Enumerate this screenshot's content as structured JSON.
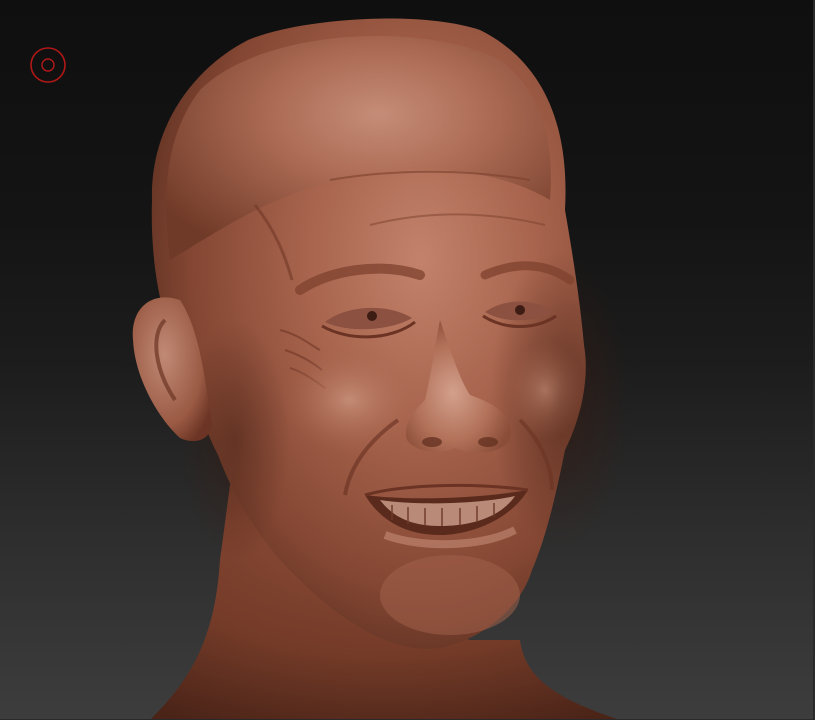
{
  "viewport": {
    "background_top": "#0f0f0f",
    "background_bottom": "#3d3d3d"
  },
  "brush_cursor": {
    "icon": "brush-cursor-icon",
    "color": "#b01818"
  },
  "model": {
    "subject": "sculpted-head",
    "material_color": "#9c5a44"
  }
}
